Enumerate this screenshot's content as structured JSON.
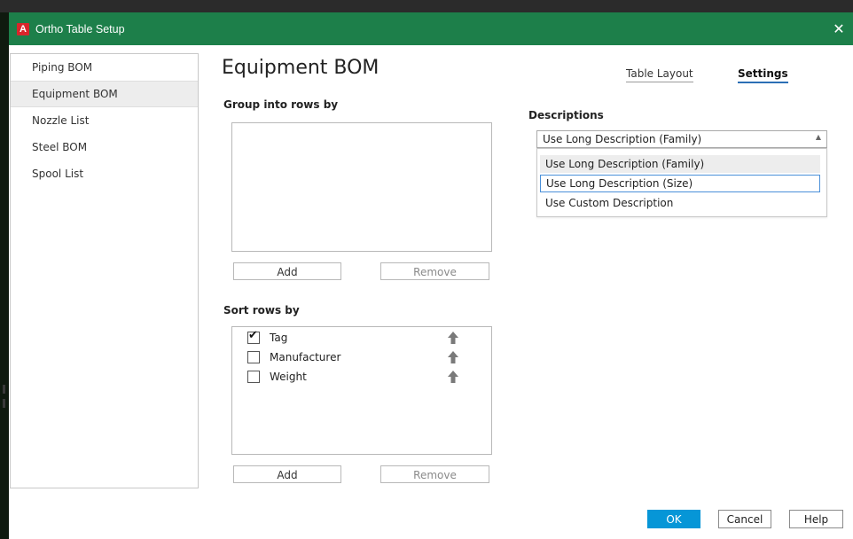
{
  "window": {
    "title": "Ortho Table Setup",
    "app_icon_letter": "A",
    "close_glyph": "✕"
  },
  "nav": {
    "items": [
      {
        "label": "Piping BOM",
        "selected": false
      },
      {
        "label": "Equipment BOM",
        "selected": true
      },
      {
        "label": "Nozzle List",
        "selected": false
      },
      {
        "label": "Steel BOM",
        "selected": false
      },
      {
        "label": "Spool List",
        "selected": false
      }
    ]
  },
  "main": {
    "page_title": "Equipment BOM",
    "tabs": [
      {
        "label": "Table Layout",
        "active": false
      },
      {
        "label": "Settings",
        "active": true
      }
    ],
    "group": {
      "label": "Group into rows by",
      "add_label": "Add",
      "remove_label": "Remove"
    },
    "sort": {
      "label": "Sort rows by",
      "items": [
        {
          "label": "Tag",
          "checked": true,
          "check_glyph": "✔",
          "arrow_icon": "arrow-up-icon"
        },
        {
          "label": "Manufacturer",
          "checked": false,
          "check_glyph": "",
          "arrow_icon": "arrow-up-icon"
        },
        {
          "label": "Weight",
          "checked": false,
          "check_glyph": "",
          "arrow_icon": "arrow-up-icon"
        }
      ],
      "add_label": "Add",
      "remove_label": "Remove"
    }
  },
  "descriptions": {
    "label": "Descriptions",
    "selected": "Use Long Description (Family)",
    "caret_glyph": "▲",
    "options": [
      "Use Long Description (Family)",
      "Use Long Description (Size)",
      "Use Custom Description"
    ]
  },
  "footer": {
    "ok_label": "OK",
    "cancel_label": "Cancel",
    "help_label": "Help"
  },
  "colors": {
    "titlebar": "#1d7f4a",
    "accent": "#0696d7",
    "tab_underline": "#2b6fb5",
    "app_icon": "#d9252b"
  }
}
